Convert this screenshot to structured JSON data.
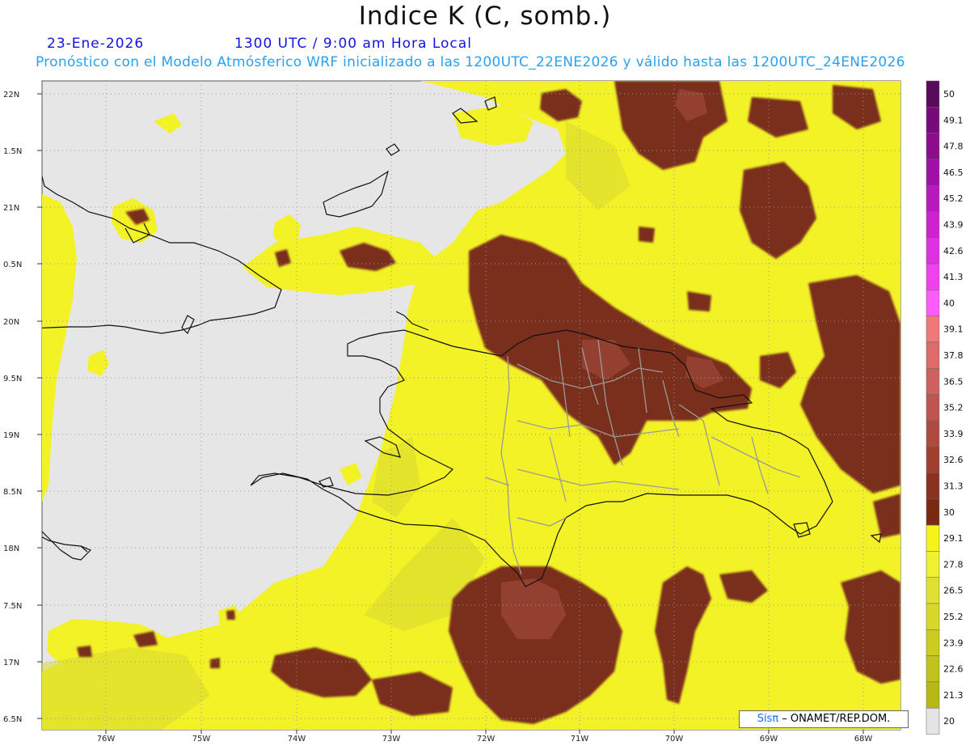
{
  "header": {
    "title": "Indice K (C, somb.)",
    "date": "23-Ene-2026",
    "time": "1300 UTC / 9:00 am Hora Local",
    "description": "Pronóstico con el Modelo Atmósferico WRF inicializado a las 1200UTC_22ENE2026 y válido hasta las  1200UTC_24ENE2026"
  },
  "axes": {
    "lat_labels": [
      "22N",
      "1.5N",
      "21N",
      "0.5N",
      "20N",
      "9.5N",
      "19N",
      "8.5N",
      "18N",
      "7.5N",
      "17N",
      "6.5N"
    ],
    "lon_labels": [
      "76W",
      "75W",
      "74W",
      "73W",
      "72W",
      "71W",
      "70W",
      "69W",
      "68W"
    ]
  },
  "colorbar": {
    "levels": [
      "50",
      "49.1",
      "47.8",
      "46.5",
      "45.2",
      "43.9",
      "42.6",
      "41.3",
      "40",
      "39.1",
      "37.8",
      "36.5",
      "35.2",
      "33.9",
      "32.6",
      "31.3",
      "30",
      "29.1",
      "27.8",
      "26.5",
      "25.2",
      "23.9",
      "22.6",
      "21.3",
      "20"
    ],
    "colors": [
      "#5a0a5a",
      "#7a0a7a",
      "#8c0c8c",
      "#a010a8",
      "#b818c0",
      "#cc22d0",
      "#e030e4",
      "#f040f0",
      "#ff5cff",
      "#f07878",
      "#e06a6a",
      "#d06060",
      "#c05550",
      "#b04a40",
      "#a03e30",
      "#8c3020",
      "#7a2a12",
      "#f4f41a",
      "#eef030",
      "#e0e030",
      "#d8d828",
      "#cccc20",
      "#c2c21c",
      "#b8b814",
      "#e4e4e4"
    ]
  },
  "credit": {
    "brand": "Sisπ",
    "text": " – ONAMET/REP.DOM."
  },
  "colors": {
    "background_sea": "#e6e6e6",
    "yellow": "#f2f226",
    "brown": "#7a2e1a",
    "coastline": "#111111",
    "provinces": "#9a9a9a"
  }
}
